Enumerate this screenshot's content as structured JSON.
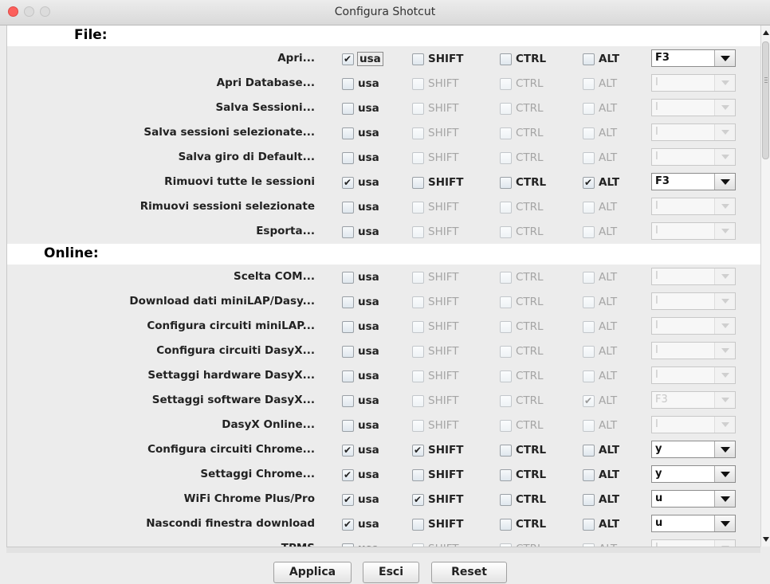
{
  "window": {
    "title": "Configura Shotcut"
  },
  "headers": {
    "usa": "usa",
    "shift": "SHIFT",
    "ctrl": "CTRL",
    "alt": "ALT"
  },
  "sections": [
    {
      "label": "File:",
      "rows": [
        {
          "label": "Apri...",
          "usa": true,
          "shift": false,
          "ctrl": false,
          "alt": false,
          "key": "F3",
          "enabled": true,
          "focused": true
        },
        {
          "label": "Apri Database...",
          "usa": false,
          "shift": false,
          "ctrl": false,
          "alt": false,
          "key": "I",
          "enabled": false
        },
        {
          "label": "Salva Sessioni...",
          "usa": false,
          "shift": false,
          "ctrl": false,
          "alt": false,
          "key": "I",
          "enabled": false
        },
        {
          "label": "Salva sessioni selezionate...",
          "usa": false,
          "shift": false,
          "ctrl": false,
          "alt": false,
          "key": "I",
          "enabled": false
        },
        {
          "label": "Salva giro di Default...",
          "usa": false,
          "shift": false,
          "ctrl": false,
          "alt": false,
          "key": "I",
          "enabled": false
        },
        {
          "label": "Rimuovi tutte le sessioni",
          "usa": true,
          "shift": false,
          "ctrl": false,
          "alt": true,
          "key": "F3",
          "enabled": true
        },
        {
          "label": "Rimuovi sessioni selezionate",
          "usa": false,
          "shift": false,
          "ctrl": false,
          "alt": false,
          "key": "I",
          "enabled": false
        },
        {
          "label": "Esporta...",
          "usa": false,
          "shift": false,
          "ctrl": false,
          "alt": false,
          "key": "I",
          "enabled": false
        }
      ]
    },
    {
      "label": "Online:",
      "rows": [
        {
          "label": "Scelta COM...",
          "usa": false,
          "shift": false,
          "ctrl": false,
          "alt": false,
          "key": "I",
          "enabled": false
        },
        {
          "label": "Download dati miniLAP/Dasy...",
          "usa": false,
          "shift": false,
          "ctrl": false,
          "alt": false,
          "key": "I",
          "enabled": false
        },
        {
          "label": "Configura circuiti miniLAP...",
          "usa": false,
          "shift": false,
          "ctrl": false,
          "alt": false,
          "key": "I",
          "enabled": false
        },
        {
          "label": "Configura circuiti DasyX...",
          "usa": false,
          "shift": false,
          "ctrl": false,
          "alt": false,
          "key": "I",
          "enabled": false
        },
        {
          "label": "Settaggi hardware DasyX...",
          "usa": false,
          "shift": false,
          "ctrl": false,
          "alt": false,
          "key": "I",
          "enabled": false
        },
        {
          "label": "Settaggi software DasyX...",
          "usa": false,
          "shift": false,
          "ctrl": false,
          "alt": true,
          "key": "F3",
          "enabled": false
        },
        {
          "label": "DasyX Online...",
          "usa": false,
          "shift": false,
          "ctrl": false,
          "alt": false,
          "key": "I",
          "enabled": false
        },
        {
          "label": "Configura circuiti Chrome...",
          "usa": true,
          "shift": true,
          "ctrl": false,
          "alt": false,
          "key": "y",
          "enabled": true
        },
        {
          "label": "Settaggi Chrome...",
          "usa": true,
          "shift": false,
          "ctrl": false,
          "alt": false,
          "key": "y",
          "enabled": true
        },
        {
          "label": "WiFi Chrome Plus/Pro",
          "usa": true,
          "shift": true,
          "ctrl": false,
          "alt": false,
          "key": "u",
          "enabled": true
        },
        {
          "label": "Nascondi finestra download",
          "usa": true,
          "shift": false,
          "ctrl": false,
          "alt": false,
          "key": "u",
          "enabled": true
        },
        {
          "label": "TPMS",
          "usa": false,
          "shift": false,
          "ctrl": false,
          "alt": false,
          "key": "I",
          "enabled": false
        }
      ]
    }
  ],
  "buttons": {
    "apply": "Applica",
    "exit": "Esci",
    "reset": "Reset"
  }
}
